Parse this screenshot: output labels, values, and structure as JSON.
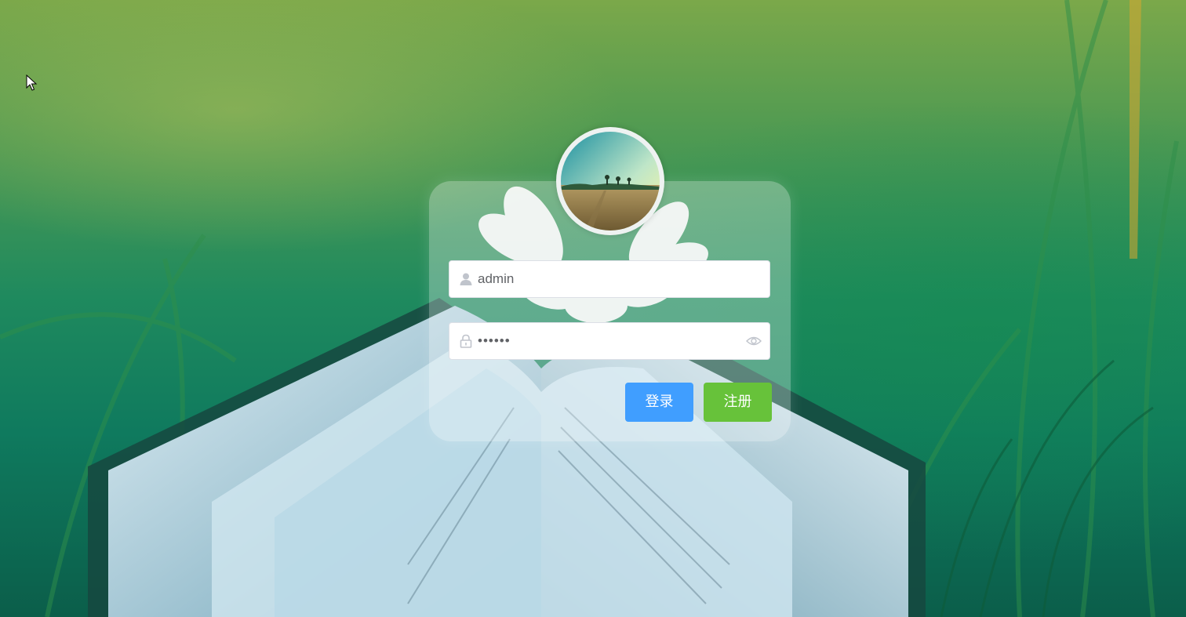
{
  "login_form": {
    "username_value": "admin",
    "password_value": "••••••",
    "login_label": "登录",
    "register_label": "注册"
  },
  "colors": {
    "login_button": "#409eff",
    "register_button": "#67c23a",
    "input_text": "#606266",
    "icon": "#c0c4cc"
  },
  "icons": {
    "username_prefix": "user-icon",
    "password_prefix": "lock-icon",
    "password_suffix": "eye-icon"
  }
}
